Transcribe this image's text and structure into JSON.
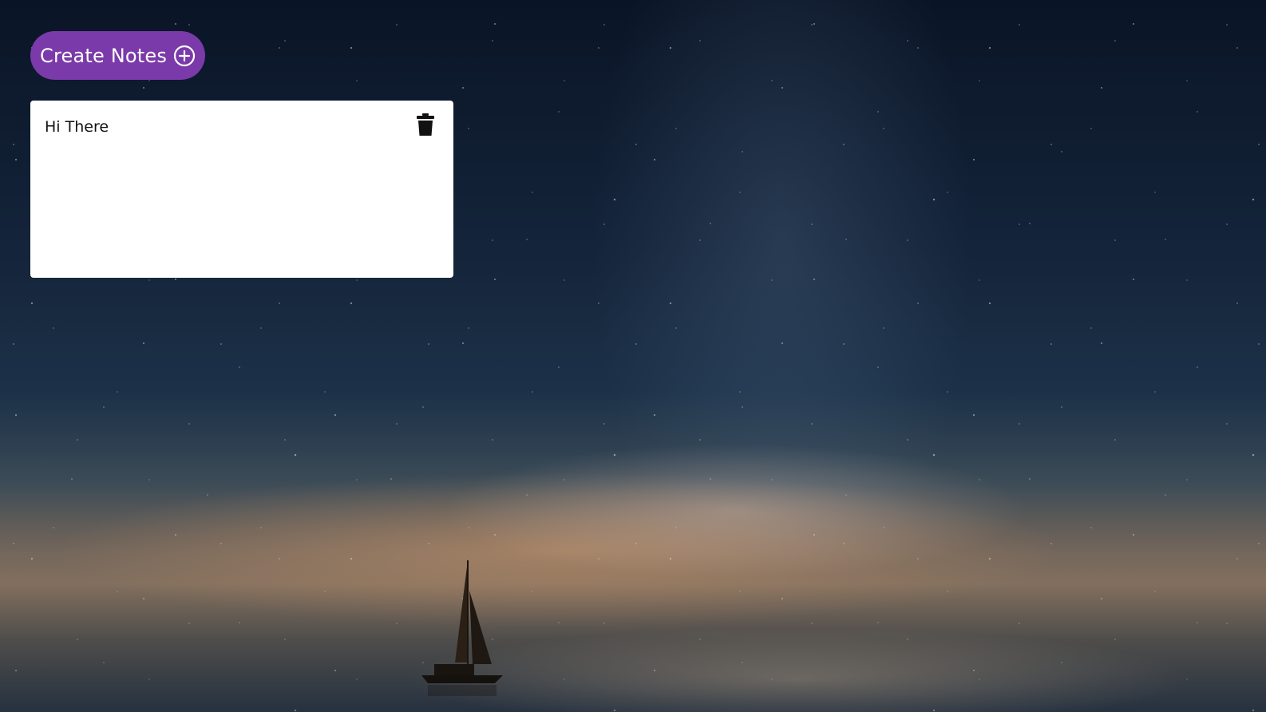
{
  "app": {
    "create_button_label": "Create Notes",
    "create_button_icon": "plus-circle-icon",
    "accent_color": "#7b3aa9"
  },
  "notes": [
    {
      "text": "Hi There",
      "delete_icon": "trash-icon"
    }
  ],
  "background": {
    "description_icon": "night-sky-sailboat-wallpaper"
  }
}
